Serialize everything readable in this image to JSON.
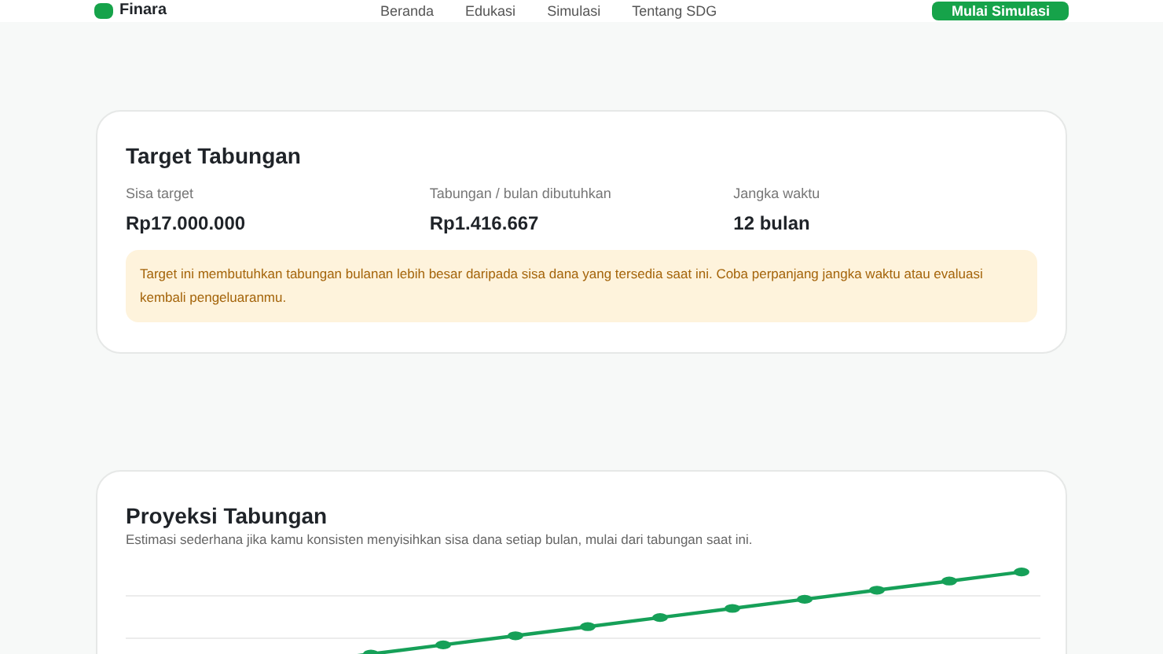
{
  "header": {
    "brand": "Finara",
    "nav": [
      "Beranda",
      "Edukasi",
      "Simulasi",
      "Tentang SDG"
    ],
    "cta": "Mulai Simulasi"
  },
  "target_card": {
    "title": "Target Tabungan",
    "stats": [
      {
        "label": "Sisa target",
        "value": "Rp17.000.000"
      },
      {
        "label": "Tabungan / bulan dibutuhkan",
        "value": "Rp1.416.667"
      },
      {
        "label": "Jangka waktu",
        "value": "12 bulan"
      }
    ],
    "warning": "Target ini membutuhkan tabungan bulanan lebih besar daripada sisa dana yang tersedia saat ini. Coba perpanjang jangka waktu atau evaluasi kembali pengeluaranmu."
  },
  "projection_card": {
    "title": "Proyeksi Tabungan",
    "subtitle": "Estimasi sederhana jika kamu konsisten menyisihkan sisa dana setiap bulan, mulai dari tabungan saat ini."
  }
}
